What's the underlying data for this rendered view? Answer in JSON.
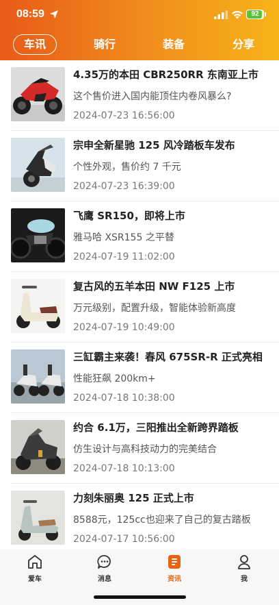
{
  "status_bar": {
    "time": "08:59",
    "battery": "92",
    "battery_level": 0.92
  },
  "tabs": [
    {
      "label": "车讯"
    },
    {
      "label": "骑行"
    },
    {
      "label": "装备"
    },
    {
      "label": "分享"
    }
  ],
  "news": [
    {
      "title": "4.35万的本田 CBR250RR 东南亚上市",
      "subtitle": "这个售价进入国内能顶住内卷风暴么?",
      "date": "2024-07-23 16:56:00"
    },
    {
      "title": "宗申全新星驰 125 风冷踏板车发布",
      "subtitle": "个性外观，售价约 7 千元",
      "date": "2024-07-23 16:39:00"
    },
    {
      "title": "飞鹰 SR150，即将上市",
      "subtitle": "雅马哈 XSR155 之平替",
      "date": "2024-07-19 11:02:00"
    },
    {
      "title": "复古风的五羊本田 NW F125 上市",
      "subtitle": "万元级别，配置升级，智能体验新高度",
      "date": "2024-07-19 10:49:00"
    },
    {
      "title": "三缸霸主来袭！春风 675SR-R 正式亮相",
      "subtitle": "性能狂飙 200km+",
      "date": "2024-07-18 10:38:00"
    },
    {
      "title": "约合 6.1万，三阳推出全新跨界踏板",
      "subtitle": "仿生设计与高科技动力的完美结合",
      "date": "2024-07-18 10:13:00"
    },
    {
      "title": "力刻朱丽奥 125 正式上市",
      "subtitle": "8588元，125cc也迎来了自己的复古踏板",
      "date": "2024-07-17 10:56:00"
    }
  ],
  "bottom_nav": [
    {
      "label": "爱车",
      "icon": "home-icon"
    },
    {
      "label": "消息",
      "icon": "chat-icon"
    },
    {
      "label": "资讯",
      "icon": "news-icon"
    },
    {
      "label": "我",
      "icon": "user-icon"
    }
  ],
  "colors": {
    "accent": "#e8630f",
    "header_start": "#e85a17",
    "header_end": "#f7b419"
  }
}
